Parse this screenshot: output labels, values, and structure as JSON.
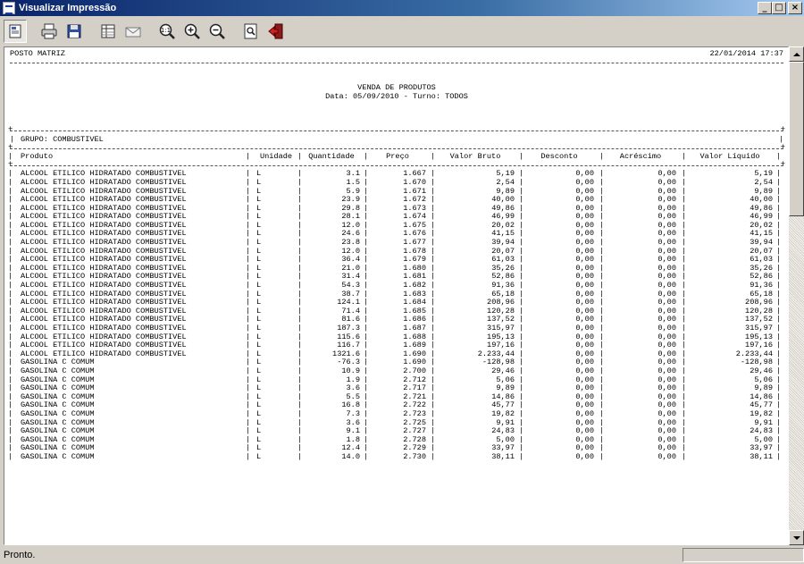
{
  "window": {
    "title": "Visualizar Impressão"
  },
  "toolbar": {
    "buttons": [
      {
        "name": "page-setup-icon"
      },
      {
        "name": "printer-icon"
      },
      {
        "name": "save-disk-icon"
      },
      {
        "name": "report-export-icon"
      },
      {
        "name": "email-envelope-icon"
      },
      {
        "name": "zoom-actual-icon"
      },
      {
        "name": "zoom-in-icon"
      },
      {
        "name": "zoom-out-icon"
      },
      {
        "name": "search-page-icon"
      },
      {
        "name": "exit-door-icon"
      }
    ]
  },
  "report": {
    "company": "POSTO MATRIZ",
    "datetime": "22/01/2014 17:37",
    "title": "VENDA DE PRODUTOS",
    "subtitle": "Data: 05/09/2010 - Turno: TODOS",
    "group": "GRUPO: COMBUSTIVEL",
    "columns": [
      "Produto",
      "Unidade",
      "Quantidade",
      "Preço",
      "Valor Bruto",
      "Desconto",
      "Acréscimo",
      "Valor Líquido"
    ],
    "rows": [
      [
        "ALCOOL ETILICO HIDRATADO COMBUSTIVEL",
        "L",
        "3.1",
        "1.667",
        "5,19",
        "0,00",
        "0,00",
        "5,19"
      ],
      [
        "ALCOOL ETILICO HIDRATADO COMBUSTIVEL",
        "L",
        "1.5",
        "1.670",
        "2,54",
        "0,00",
        "0,00",
        "2,54"
      ],
      [
        "ALCOOL ETILICO HIDRATADO COMBUSTIVEL",
        "L",
        "5.9",
        "1.671",
        "9,89",
        "0,00",
        "0,00",
        "9,89"
      ],
      [
        "ALCOOL ETILICO HIDRATADO COMBUSTIVEL",
        "L",
        "23.9",
        "1.672",
        "40,00",
        "0,00",
        "0,00",
        "40,00"
      ],
      [
        "ALCOOL ETILICO HIDRATADO COMBUSTIVEL",
        "L",
        "29.8",
        "1.673",
        "49,86",
        "0,00",
        "0,00",
        "49,86"
      ],
      [
        "ALCOOL ETILICO HIDRATADO COMBUSTIVEL",
        "L",
        "28.1",
        "1.674",
        "46,99",
        "0,00",
        "0,00",
        "46,99"
      ],
      [
        "ALCOOL ETILICO HIDRATADO COMBUSTIVEL",
        "L",
        "12.0",
        "1.675",
        "20,02",
        "0,00",
        "0,00",
        "20,02"
      ],
      [
        "ALCOOL ETILICO HIDRATADO COMBUSTIVEL",
        "L",
        "24.6",
        "1.676",
        "41,15",
        "0,00",
        "0,00",
        "41,15"
      ],
      [
        "ALCOOL ETILICO HIDRATADO COMBUSTIVEL",
        "L",
        "23.8",
        "1.677",
        "39,94",
        "0,00",
        "0,00",
        "39,94"
      ],
      [
        "ALCOOL ETILICO HIDRATADO COMBUSTIVEL",
        "L",
        "12.0",
        "1.678",
        "20,07",
        "0,00",
        "0,00",
        "20,07"
      ],
      [
        "ALCOOL ETILICO HIDRATADO COMBUSTIVEL",
        "L",
        "36.4",
        "1.679",
        "61,03",
        "0,00",
        "0,00",
        "61,03"
      ],
      [
        "ALCOOL ETILICO HIDRATADO COMBUSTIVEL",
        "L",
        "21.0",
        "1.680",
        "35,26",
        "0,00",
        "0,00",
        "35,26"
      ],
      [
        "ALCOOL ETILICO HIDRATADO COMBUSTIVEL",
        "L",
        "31.4",
        "1.681",
        "52,86",
        "0,00",
        "0,00",
        "52,86"
      ],
      [
        "ALCOOL ETILICO HIDRATADO COMBUSTIVEL",
        "L",
        "54.3",
        "1.682",
        "91,36",
        "0,00",
        "0,00",
        "91,36"
      ],
      [
        "ALCOOL ETILICO HIDRATADO COMBUSTIVEL",
        "L",
        "38.7",
        "1.683",
        "65,18",
        "0,00",
        "0,00",
        "65,18"
      ],
      [
        "ALCOOL ETILICO HIDRATADO COMBUSTIVEL",
        "L",
        "124.1",
        "1.684",
        "208,96",
        "0,00",
        "0,00",
        "208,96"
      ],
      [
        "ALCOOL ETILICO HIDRATADO COMBUSTIVEL",
        "L",
        "71.4",
        "1.685",
        "120,28",
        "0,00",
        "0,00",
        "120,28"
      ],
      [
        "ALCOOL ETILICO HIDRATADO COMBUSTIVEL",
        "L",
        "81.6",
        "1.686",
        "137,52",
        "0,00",
        "0,00",
        "137,52"
      ],
      [
        "ALCOOL ETILICO HIDRATADO COMBUSTIVEL",
        "L",
        "187.3",
        "1.687",
        "315,97",
        "0,00",
        "0,00",
        "315,97"
      ],
      [
        "ALCOOL ETILICO HIDRATADO COMBUSTIVEL",
        "L",
        "115.6",
        "1.688",
        "195,13",
        "0,00",
        "0,00",
        "195,13"
      ],
      [
        "ALCOOL ETILICO HIDRATADO COMBUSTIVEL",
        "L",
        "116.7",
        "1.689",
        "197,16",
        "0,00",
        "0,00",
        "197,16"
      ],
      [
        "ALCOOL ETILICO HIDRATADO COMBUSTIVEL",
        "L",
        "1321.6",
        "1.690",
        "2.233,44",
        "0,00",
        "0,00",
        "2.233,44"
      ],
      [
        "GASOLINA C COMUM",
        "L",
        "-76.3",
        "1.690",
        "-128,98",
        "0,00",
        "0,00",
        "-128,98"
      ],
      [
        "GASOLINA C COMUM",
        "L",
        "10.9",
        "2.700",
        "29,46",
        "0,00",
        "0,00",
        "29,46"
      ],
      [
        "GASOLINA C COMUM",
        "L",
        "1.9",
        "2.712",
        "5,06",
        "0,00",
        "0,00",
        "5,06"
      ],
      [
        "GASOLINA C COMUM",
        "L",
        "3.6",
        "2.717",
        "9,89",
        "0,00",
        "0,00",
        "9,89"
      ],
      [
        "GASOLINA C COMUM",
        "L",
        "5.5",
        "2.721",
        "14,86",
        "0,00",
        "0,00",
        "14,86"
      ],
      [
        "GASOLINA C COMUM",
        "L",
        "16.8",
        "2.722",
        "45,77",
        "0,00",
        "0,00",
        "45,77"
      ],
      [
        "GASOLINA C COMUM",
        "L",
        "7.3",
        "2.723",
        "19,82",
        "0,00",
        "0,00",
        "19,82"
      ],
      [
        "GASOLINA C COMUM",
        "L",
        "3.6",
        "2.725",
        "9,91",
        "0,00",
        "0,00",
        "9,91"
      ],
      [
        "GASOLINA C COMUM",
        "L",
        "9.1",
        "2.727",
        "24,83",
        "0,00",
        "0,00",
        "24,83"
      ],
      [
        "GASOLINA C COMUM",
        "L",
        "1.8",
        "2.728",
        "5,00",
        "0,00",
        "0,00",
        "5,00"
      ],
      [
        "GASOLINA C COMUM",
        "L",
        "12.4",
        "2.729",
        "33,97",
        "0,00",
        "0,00",
        "33,97"
      ],
      [
        "GASOLINA C COMUM",
        "L",
        "14.0",
        "2.730",
        "38,11",
        "0,00",
        "0,00",
        "38,11"
      ]
    ]
  },
  "status": {
    "text": "Pronto."
  }
}
